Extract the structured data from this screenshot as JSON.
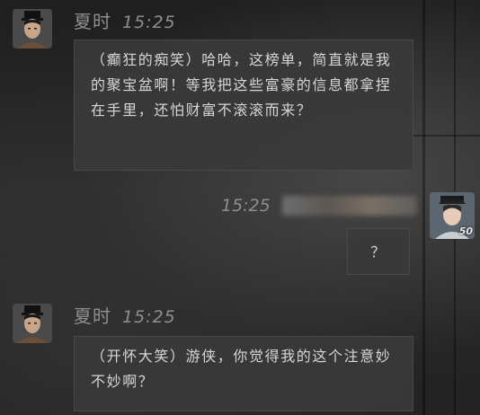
{
  "messages": [
    {
      "sender": "夏时",
      "time": "15:25",
      "text": "（癫狂的痴笑）哈哈，这榜单，简直就是我的聚宝盆啊！等我把这些富豪的信息都拿捏在手里，还怕财富不滚滚而来？"
    },
    {
      "sender_blurred": true,
      "time": "15:25",
      "text": "？",
      "level": "50"
    },
    {
      "sender": "夏时",
      "time": "15:25",
      "text": "（开怀大笑）游侠，你觉得我的这个注意妙不妙啊？"
    }
  ]
}
